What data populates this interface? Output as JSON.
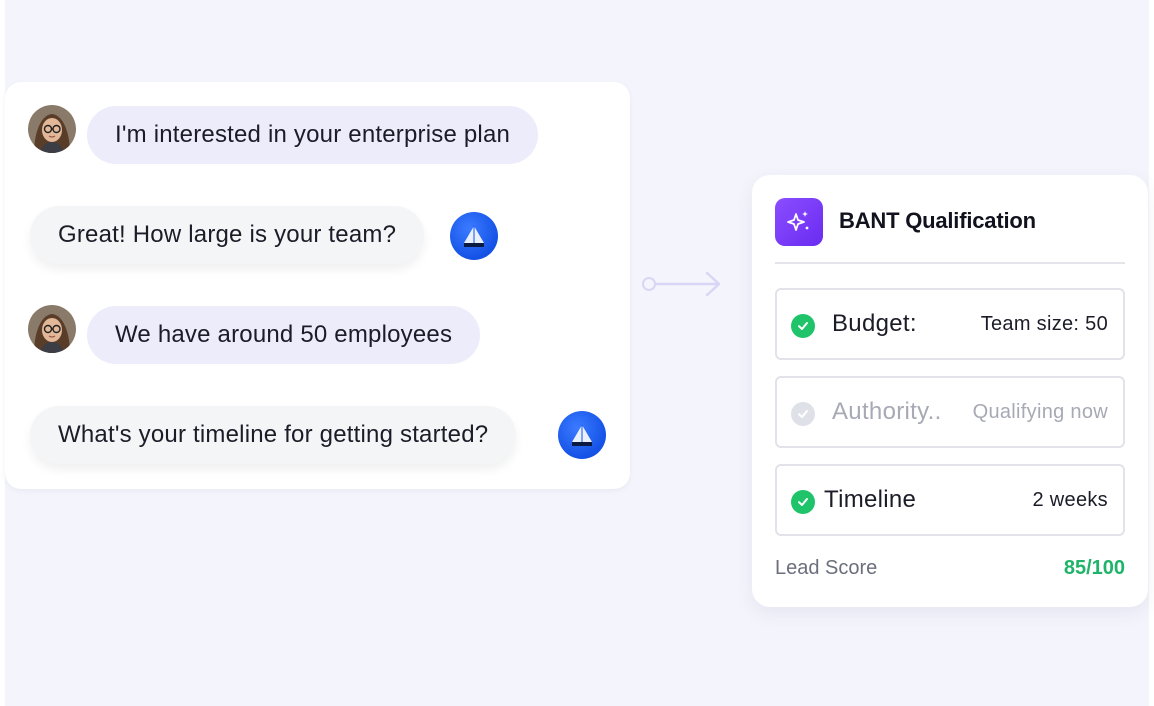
{
  "chat": {
    "messages": [
      {
        "sender": "user",
        "text": "I'm interested in your enterprise plan"
      },
      {
        "sender": "bot",
        "text": "Great! How large is your team?"
      },
      {
        "sender": "user",
        "text": "We have around 50 employees"
      },
      {
        "sender": "bot",
        "text": "What's your timeline for getting started?"
      }
    ]
  },
  "bant": {
    "title": "BANT Qualification",
    "icon": "sparkles-icon",
    "rows": [
      {
        "label": "Budget:",
        "value": "Team size: 50",
        "status": "complete"
      },
      {
        "label": "Authority..",
        "value": "Qualifying now",
        "status": "pending"
      },
      {
        "label": "Timeline",
        "value": "2 weeks",
        "status": "complete"
      }
    ],
    "lead_score_label": "Lead Score",
    "lead_score_value": "85/100"
  },
  "colors": {
    "accent": "#7b3cf5",
    "success": "#1fc46a",
    "bot_avatar": "#1452e6",
    "user_bubble": "#ececfb"
  }
}
